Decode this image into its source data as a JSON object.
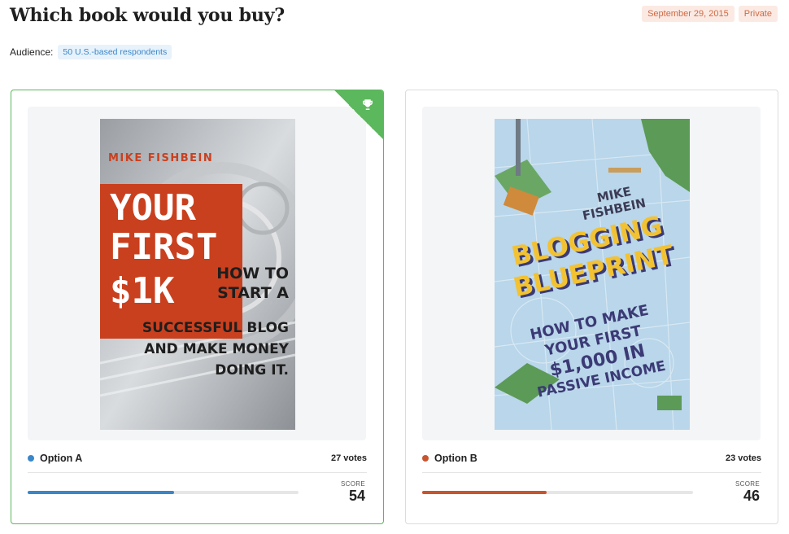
{
  "header": {
    "title": "Which book would you buy?",
    "date": "September 29, 2015",
    "visibility": "Private"
  },
  "audience": {
    "label": "Audience:",
    "value": "50 U.S.-based respondents"
  },
  "options": [
    {
      "label": "Option A",
      "votes": "27 votes",
      "score_label": "SCORE",
      "score": "54",
      "progress": 0.54,
      "color": "#3a86c8",
      "winner": true,
      "winner_icon": "trophy-icon",
      "cover": {
        "author": "MIKE FISHBEIN",
        "title_lines": [
          "YOUR",
          "FIRST",
          "$1K"
        ],
        "subtitle_lines": [
          "HOW TO",
          "START A",
          "SUCCESSFUL BLOG",
          "AND MAKE MONEY",
          "DOING IT."
        ]
      }
    },
    {
      "label": "Option B",
      "votes": "23 votes",
      "score_label": "SCORE",
      "score": "46",
      "progress": 0.46,
      "color": "#c8552e",
      "winner": false,
      "cover": {
        "author_lines": [
          "MIKE",
          "FISHBEIN"
        ],
        "title_lines": [
          "BLOGGING",
          "BLUEPRINT"
        ],
        "subtitle_lines": [
          "HOW TO MAKE",
          "YOUR FIRST",
          "$1,000 IN",
          "PASSIVE INCOME"
        ]
      }
    }
  ]
}
